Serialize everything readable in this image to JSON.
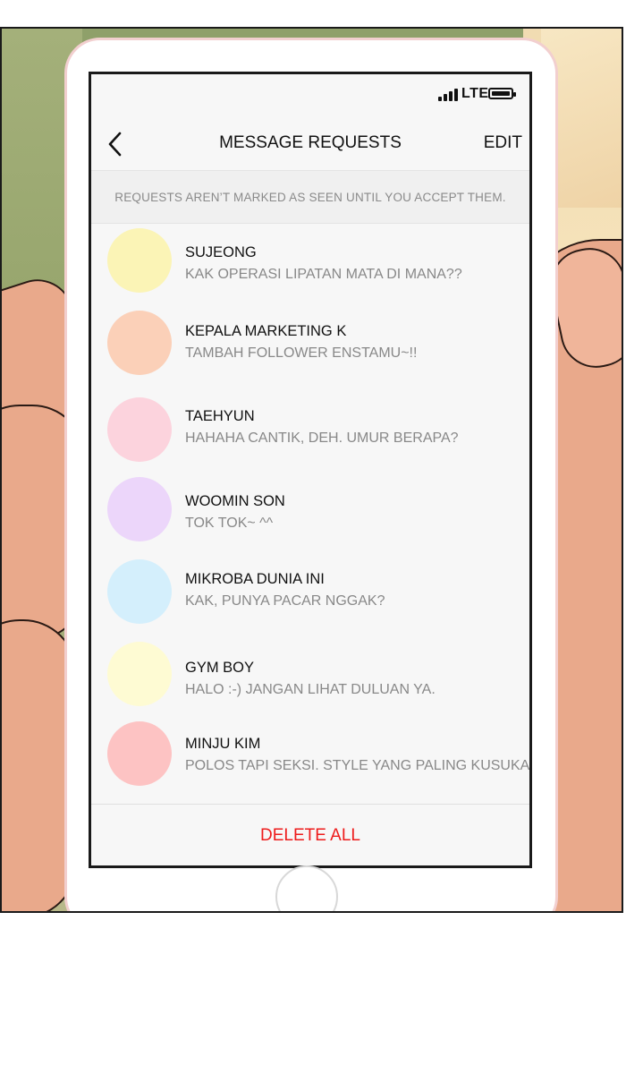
{
  "status": {
    "network": "LTE"
  },
  "nav": {
    "title": "MESSAGE REQUESTS",
    "edit_label": "EDIT",
    "back_icon": "chevron-left-icon"
  },
  "notice": "REQUESTS AREN’T MARKED AS SEEN UNTIL YOU ACCEPT THEM.",
  "requests": [
    {
      "name": "SUJEONG",
      "message": "KAK OPERASI LIPATAN MATA DI MANA??",
      "avatar_color": "#fbf4b6"
    },
    {
      "name": "KEPALA MARKETING K",
      "message": "TAMBAH FOLLOWER ENSTAMU~!!",
      "avatar_color": "#fbd0b8"
    },
    {
      "name": "TAEHYUN",
      "message": "HAHAHA CANTIK, DEH. UMUR BERAPA?",
      "avatar_color": "#fcd3dd"
    },
    {
      "name": "WOOMIN SON",
      "message": "TOK TOK~ ^^",
      "avatar_color": "#ecd6fa"
    },
    {
      "name": "MIKROBA DUNIA INI",
      "message": "KAK, PUNYA PACAR NGGAK?",
      "avatar_color": "#d4effc"
    },
    {
      "name": "GYM BOY",
      "message": "HALO :-)  JANGAN LIHAT DULUAN YA.",
      "avatar_color": "#fefbd3"
    },
    {
      "name": "MINJU KIM",
      "message": "POLOS TAPI SEKSI. STYLE YANG PALING KUSUKA...",
      "avatar_color": "#fdc3c3"
    }
  ],
  "footer": {
    "delete_all_label": "DELETE ALL",
    "delete_color": "#ee1c1c"
  }
}
